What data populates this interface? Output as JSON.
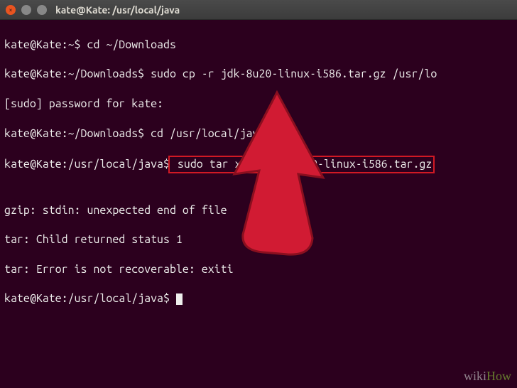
{
  "window": {
    "title": "kate@Kate: /usr/local/java"
  },
  "terminal": {
    "lines": [
      {
        "prompt": "kate@Kate:~$",
        "cmd": " cd ~/Downloads"
      },
      {
        "prompt": "kate@Kate:~/Downloads$",
        "cmd": " sudo cp -r jdk-8u20-linux-i586.tar.gz /usr/lo"
      },
      {
        "text": "[sudo] password for kate:"
      },
      {
        "prompt": "kate@Kate:~/Downloads$",
        "cmd": " cd /usr/local/java"
      },
      {
        "prompt": "kate@Kate:/usr/local/java$",
        "cmd_boxed": " sudo tar xvzf jdk-8u20-linux-i586.tar.gz"
      },
      {
        "text": ""
      },
      {
        "text": "gzip: stdin: unexpected end of file"
      },
      {
        "text": "tar: Child returned status 1"
      },
      {
        "text": "tar: Error is not recoverable: exiti"
      },
      {
        "prompt": "kate@Kate:/usr/local/java$",
        "cursor": true
      }
    ]
  },
  "watermark": {
    "wiki": "wiki",
    "how": "How"
  }
}
